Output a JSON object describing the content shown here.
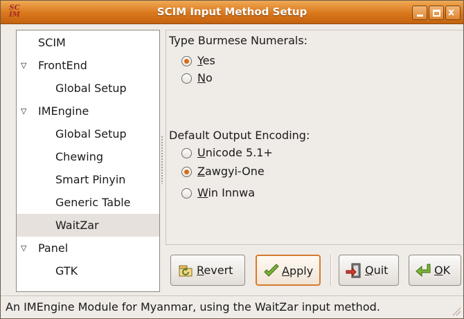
{
  "window": {
    "title": "SCIM Input Method Setup",
    "icon": "scim-logo-icon",
    "icon_text_1": "SC",
    "icon_text_2": "IM",
    "accent_color": "#d9771b"
  },
  "sidebar": {
    "items": [
      {
        "label": "SCIM",
        "level": 0,
        "expander": ""
      },
      {
        "label": "FrontEnd",
        "level": 0,
        "expander": "expanded"
      },
      {
        "label": "Global Setup",
        "level": 1,
        "expander": ""
      },
      {
        "label": "IMEngine",
        "level": 0,
        "expander": "expanded"
      },
      {
        "label": "Global Setup",
        "level": 1,
        "expander": ""
      },
      {
        "label": "Chewing",
        "level": 1,
        "expander": ""
      },
      {
        "label": "Smart Pinyin",
        "level": 1,
        "expander": ""
      },
      {
        "label": "Generic Table",
        "level": 1,
        "expander": ""
      },
      {
        "label": "WaitZar",
        "level": 1,
        "expander": "",
        "selected": true
      },
      {
        "label": "Panel",
        "level": 0,
        "expander": "expanded"
      },
      {
        "label": "GTK",
        "level": 1,
        "expander": ""
      }
    ],
    "expander_glyph": "▽"
  },
  "numerals": {
    "title": "Type Burmese Numerals:",
    "options": [
      {
        "label": "Yes",
        "mnemonic": "Y",
        "rest": "es",
        "checked": true
      },
      {
        "label": "No",
        "mnemonic": "N",
        "rest": "o",
        "checked": false
      }
    ]
  },
  "encoding": {
    "title": "Default Output Encoding:",
    "options": [
      {
        "label": "Unicode 5.1+",
        "mnemonic": "U",
        "rest": "nicode 5.1+",
        "checked": false
      },
      {
        "label": "Zawgyi-One",
        "mnemonic": "Z",
        "rest": "awgyi-One",
        "checked": true
      },
      {
        "label": "Win Innwa",
        "mnemonic": "W",
        "rest": "in Innwa",
        "checked": false
      }
    ]
  },
  "buttons": {
    "revert": {
      "label": "Revert",
      "mnemonic": "R",
      "rest": "evert",
      "icon": "revert-icon"
    },
    "apply": {
      "label": "Apply",
      "mnemonic": "A",
      "rest": "pply",
      "icon": "checkmark-icon"
    },
    "quit": {
      "label": "Quit",
      "mnemonic": "Q",
      "rest": "uit",
      "icon": "exit-door-icon"
    },
    "ok": {
      "label": "OK",
      "mnemonic": "O",
      "rest": "K",
      "icon": "enter-arrow-icon"
    }
  },
  "status": {
    "text": "An IMEngine Module for Myanmar, using the WaitZar input method."
  },
  "window_controls": {
    "close_glyph": "x"
  }
}
